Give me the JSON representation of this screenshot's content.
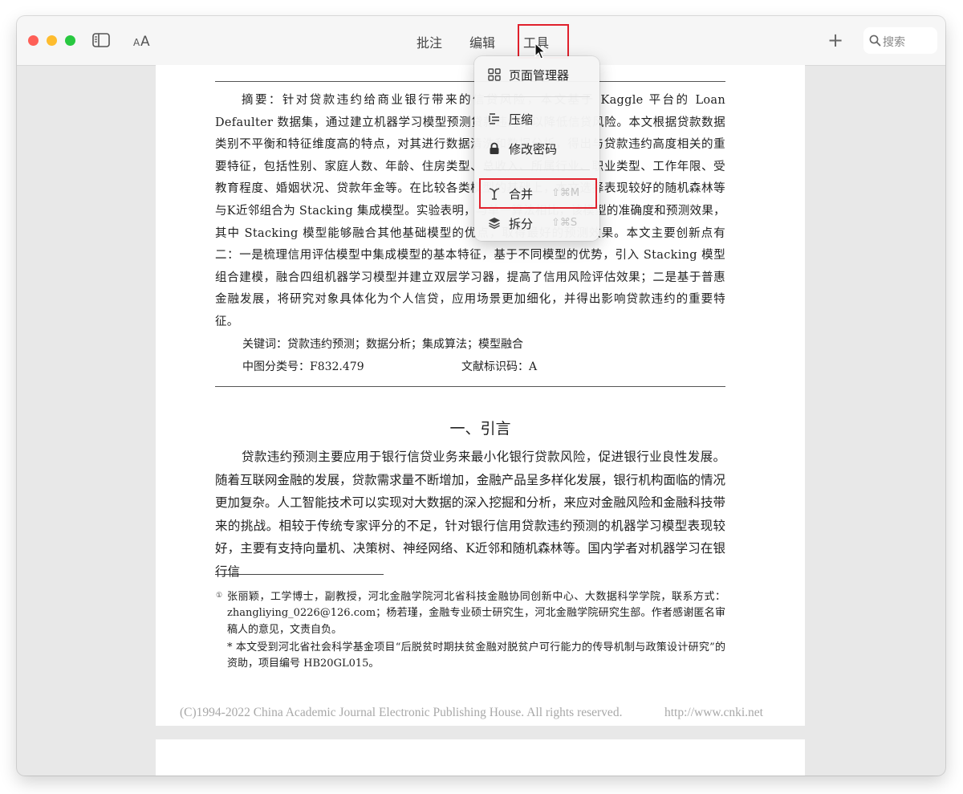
{
  "toolbar": {
    "menus": [
      "批注",
      "编辑",
      "工具"
    ],
    "search_placeholder": "搜索",
    "add_label": "+",
    "font_size_icon": "AA-icon",
    "sidebar_icon": "sidebar-icon"
  },
  "tools_menu": {
    "items": [
      {
        "label": "页面管理器",
        "icon": "grid-icon"
      },
      {
        "label": "压缩",
        "icon": "compress-icon"
      },
      {
        "label": "修改密码",
        "icon": "lock-icon"
      },
      {
        "label": "合并",
        "icon": "merge-icon",
        "shortcut": "⇧⌘M"
      },
      {
        "label": "拆分",
        "icon": "layers-icon",
        "shortcut": "⇧⌘S"
      }
    ]
  },
  "document": {
    "abstract_label": "摘要：",
    "abstract_text": "针对贷款违约给商业银行带来的信贷风险，本文基于 Kaggle 平台的 Loan Defaulter 数据集，通过建立机器学习模型预测贷款违约，以降低信贷风险。本文根据贷款数据类别不平衡和特征维度高的特点，对其进行数据清洗和数据分析，得出与贷款违约高度相关的重要特征，包括性别、家庭人数、年龄、住房类型、总收入、所属行业、职业类型、工作年限、受教育程度、婚姻状况、贷款年金等。在比较各类模型的基础上，本文选择表现较好的随机森林等与K近邻组合为 Stacking 集成模型。实验表明，与单一算法相比，该模型的准确度和预测效果，其中 Stacking 模型能够融合其他基础模型的优点，取得最好的预测效果。本文主要创新点有二：一是梳理信用评估模型中集成模型的基本特征，基于不同模型的优势，引入 Stacking 模型组合建模，融合四组机器学习模型并建立双层学习器，提高了信用风险评估效果；二是基于普惠金融发展，将研究对象具体化为个人信贷，应用场景更加细化，并得出影响贷款违约的重要特征。",
    "keywords_label": "关键词：",
    "keywords": "贷款违约预测；数据分析；集成算法；模型融合",
    "classification_label": "中图分类号：",
    "classification": "F832.479",
    "doc_id_label": "文献标识码：",
    "doc_id": "A",
    "section_title": "一、引言",
    "intro_text": "贷款违约预测主要应用于银行信贷业务来最小化银行贷款风险，促进银行业良性发展。随着互联网金融的发展，贷款需求量不断增加，金融产品呈多样化发展，银行机构面临的情况更加复杂。人工智能技术可以实现对大数据的深入挖掘和分析，来应对金融风险和金融科技带来的挑战。相较于传统专家评分的不足，针对银行信用贷款违约预测的机器学习模型表现较好，主要有支持向量机、决策树、神经网络、K近邻和随机森林等。国内学者对机器学习在银行信",
    "footnote_mark": "①",
    "footnote1": "张丽颖，工学博士，副教授，河北金融学院河北省科技金融协同创新中心、大数据科学学院，联系方式：zhangliying_0226@126.com；杨若瑾，金融专业硕士研究生，河北金融学院研究生部。作者感谢匿名审稿人的意见，文责自负。",
    "footnote2": "* 本文受到河北省社会科学基金项目“后脱贫时期扶贫金融对脱贫户可行能力的传导机制与政策设计研究”的资助，项目编号 HB20GL015。",
    "copyright": "(C)1994-2022 China Academic Journal Electronic Publishing House. All rights reserved.",
    "copyright_url": "http://www.cnki.net"
  },
  "colors": {
    "highlight": "#e0202c",
    "traffic_red": "#fe5f57",
    "traffic_yellow": "#febc2e",
    "traffic_green": "#28c840"
  }
}
